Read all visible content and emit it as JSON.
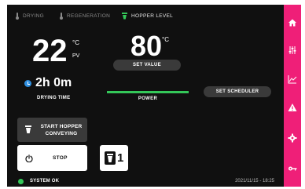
{
  "tabs": [
    {
      "label": "DRYING",
      "icon": "thermometer-icon",
      "active": false
    },
    {
      "label": "REGENERATION",
      "icon": "thermometer-icon",
      "active": false
    },
    {
      "label": "HOPPER LEVEL",
      "icon": "hopper-icon",
      "active": true
    }
  ],
  "process": {
    "pv_value": "22",
    "pv_unit": "°C",
    "pv_label": "PV",
    "set_value": "80",
    "set_unit": "°C",
    "set_value_label": "SET VALUE"
  },
  "drying": {
    "time": "2h 0m",
    "label": "DRYING TIME",
    "icon": "clock-icon"
  },
  "power": {
    "label": "POWER",
    "level": 1.0
  },
  "actions": {
    "set_scheduler": "SET SCHEDULER",
    "start_hopper_conveying": "START HOPPER CONVEYING",
    "stop": "STOP",
    "hopper_count": "1"
  },
  "status": {
    "text": "SYSTEM OK",
    "timestamp": "2021/11/15 - 18:25"
  },
  "sidebar": {
    "items": [
      {
        "name": "home-icon"
      },
      {
        "name": "settings-sliders-icon"
      },
      {
        "name": "chart-icon"
      },
      {
        "name": "alarm-warning-icon"
      },
      {
        "name": "gear-icon"
      },
      {
        "name": "key-icon"
      }
    ]
  },
  "colors": {
    "accent": "#ef1f78",
    "ok": "#34c759",
    "clock": "#2f8fe0",
    "background": "#101010",
    "button": "#3a3a3a"
  }
}
